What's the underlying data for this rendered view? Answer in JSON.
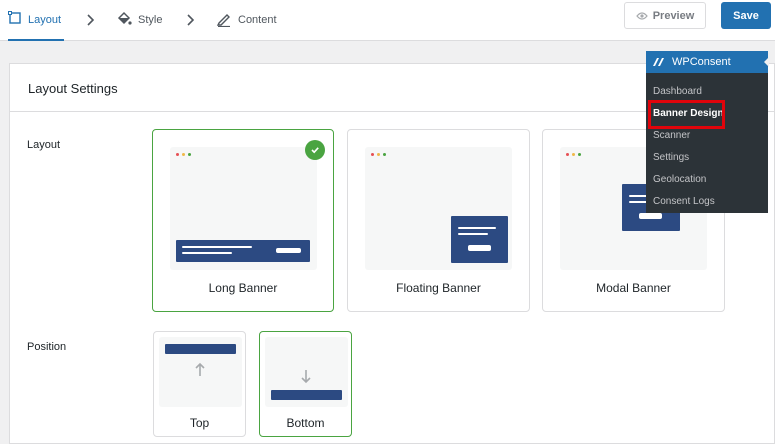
{
  "steps": [
    {
      "label": "Layout",
      "icon": "layout-icon",
      "active": true
    },
    {
      "label": "Style",
      "icon": "paint-bucket-icon",
      "active": false
    },
    {
      "label": "Content",
      "icon": "pen-icon",
      "active": false
    }
  ],
  "actions": {
    "preview_label": "Preview",
    "save_label": "Save"
  },
  "panel": {
    "title": "Layout Settings"
  },
  "layout_section": {
    "label": "Layout",
    "options": [
      {
        "name": "Long Banner",
        "selected": true
      },
      {
        "name": "Floating Banner",
        "selected": false
      },
      {
        "name": "Modal Banner",
        "selected": false
      }
    ]
  },
  "position_section": {
    "label": "Position",
    "options": [
      {
        "name": "Top",
        "selected": false
      },
      {
        "name": "Bottom",
        "selected": true
      }
    ]
  },
  "wp_menu": {
    "title": "WPConsent",
    "items": [
      "Dashboard",
      "Banner Design",
      "Scanner",
      "Settings",
      "Geolocation",
      "Consent Logs"
    ],
    "current": "Banner Design"
  },
  "colors": {
    "accent": "#2271b1",
    "selected_border": "#4aa441",
    "banner": "#2c4a82",
    "wp_sidebar": "#2c3338",
    "highlight": "#e0040b"
  }
}
